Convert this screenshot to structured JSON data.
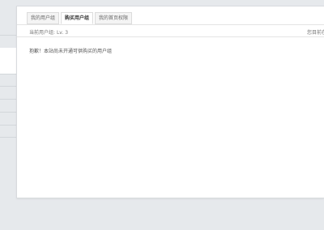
{
  "tabs": [
    {
      "label": "我的用户组",
      "active": false
    },
    {
      "label": "购买用户组",
      "active": true
    },
    {
      "label": "我的首页权限",
      "active": false
    }
  ],
  "toolbar": {
    "current_group_label": "当前用户组:",
    "current_group_value": "Lv. 3",
    "right_text": "您目前在"
  },
  "content": {
    "notice": "抱歉！本站尚未开通可供购买的用户组"
  }
}
